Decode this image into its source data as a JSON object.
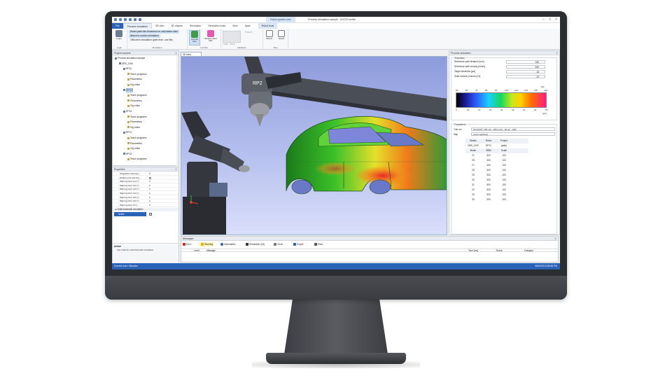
{
  "window": {
    "title": "Process simulation sample - DXC20.xmlite",
    "context_tab_group": "Robot specific tools",
    "context_tab": "Robot tools"
  },
  "ribbon_tabs": [
    "File",
    "Process simulation",
    "3D view",
    "3D objects",
    "Simulation",
    "Simulation tools",
    "View",
    "Apps"
  ],
  "ribbon": {
    "login_label": "Login",
    "login_group": "Login",
    "sim_options": [
      "Reset paint film thickness on calculation start",
      "Attach to motion simulation",
      "Offscreen simulation (path from .cvs file)"
    ],
    "simulation_group": "Simulation",
    "use_list_label": "Use list files",
    "sample_paint_label": "Sample paint files",
    "load_label": "Load",
    "save_label": "Save",
    "list_group": "List files",
    "validation_group": "Validation",
    "export_label": "Export",
    "import_label": "Import",
    "export_small": "Export",
    "map_group": "Map"
  },
  "project_explorer": {
    "title": "Project explorer",
    "items": [
      {
        "label": "Process simulation sample",
        "level": 0
      },
      {
        "label": "DBS_2100",
        "level": 1
      },
      {
        "label": "RP11",
        "level": 2
      },
      {
        "label": "Teach programs",
        "level": 3
      },
      {
        "label": "Parameters",
        "level": 3
      },
      {
        "label": "Cfg editor",
        "level": 3
      },
      {
        "label": "RP12",
        "level": 2,
        "selected": true
      },
      {
        "label": "Teach programs",
        "level": 3
      },
      {
        "label": "Parameters",
        "level": 3
      },
      {
        "label": "Cfg editor",
        "level": 3
      },
      {
        "label": "RP13",
        "level": 2
      },
      {
        "label": "Teach programs",
        "level": 3
      },
      {
        "label": "Parameters",
        "level": 3
      },
      {
        "label": "Cfg editor",
        "level": 3
      },
      {
        "label": "RP21",
        "level": 2
      },
      {
        "label": "Teach programs",
        "level": 3
      },
      {
        "label": "Parameters",
        "level": 3
      },
      {
        "label": "Cfg editor",
        "level": 3
      },
      {
        "label": "RP22",
        "level": 2
      },
      {
        "label": "Teach programs",
        "level": 3
      }
    ]
  },
  "properties": {
    "title": "Properties",
    "rows": [
      {
        "key": "Singularity warning (...",
        "value": "0"
      },
      {
        "key": "Enable joint warning ...",
        "checkbox": true
      },
      {
        "key": "Warning limit 'A1' [°]",
        "value": "0"
      },
      {
        "key": "Warning limit 'A2' [°]",
        "value": "0"
      },
      {
        "key": "Warning limit 'A3' [°]",
        "value": "0"
      },
      {
        "key": "Warning limit 'A4' [°]",
        "value": "0"
      },
      {
        "key": "Warning limit 'A5' [°]",
        "value": "0"
      },
      {
        "key": "Warning limit 'A6' [°]",
        "value": "0"
      },
      {
        "key": "Warning limit 'A7' [...",
        "value": "0"
      }
    ],
    "section": "Multi kinematic simulation",
    "active_label": "Active",
    "desc_title": "Active",
    "desc_text": "Use robot for multi kinematic simulation"
  },
  "view3d": {
    "tab": "3D view",
    "robot_label": "RP2"
  },
  "process_sim": {
    "title": "Process simulation",
    "simulation_group": "Simulation",
    "fields": [
      {
        "label": "Reference path distance [mm]",
        "value": "150"
      },
      {
        "label": "Reference path velocity [mm/s]",
        "value": "450"
      },
      {
        "label": "Target thickness [µm]",
        "value": "18"
      },
      {
        "label": "Solid content (volume) [%]",
        "value": "23"
      }
    ],
    "scale_ticks": [
      "50",
      "60",
      "75",
      "85",
      "90",
      "100",
      "110",
      "125",
      "135",
      "145"
    ],
    "scale_unit_top": "[%]",
    "scale_bottom": [
      "0",
      "10",
      "13",
      "15",
      "16",
      "18",
      "21",
      "23",
      "25"
    ],
    "scale_unit_bottom": "[µm]",
    "parameters_group": "Parameters",
    "trial_label": "Trial run",
    "trial_value": "23.29 PM | 150 mm - 450 mm/s - 18 µm - 23%",
    "map_label": "Map",
    "map_value": "(none selected)",
    "table_header": [
      "Station",
      "Robot",
      "Project"
    ],
    "station_row": [
      "DBS_2100",
      "RP11",
      "(path)"
    ],
    "sub_header": [
      "Brush",
      "SB50",
      "Scale"
    ],
    "rows": [
      [
        "21",
        "500",
        "100"
      ],
      [
        "25",
        "500",
        "100"
      ],
      [
        "27",
        "500",
        "100"
      ],
      [
        "28",
        "500",
        "100"
      ],
      [
        "29",
        "500",
        "100"
      ],
      [
        "30",
        "500",
        "100"
      ],
      [
        "31",
        "500",
        "100"
      ],
      [
        "32",
        "500",
        "100"
      ],
      [
        "33",
        "500",
        "100"
      ],
      [
        "34",
        "500",
        "100"
      ]
    ]
  },
  "messages": {
    "title": "Messages",
    "buttons": [
      "Error",
      "Warning",
      "Information",
      "Simulation (26)",
      "Clear",
      "Export",
      "View"
    ],
    "columns": [
      "Level",
      "Message",
      "Time [ms]",
      "Robot",
      "Category"
    ]
  },
  "status": {
    "user": "Current user: Sitoncho",
    "datetime": "8/6/2020 5:36:58 PM"
  },
  "colors": {
    "accent": "#2a62b8",
    "sky_top": "#8e9bdc",
    "sky_bottom": "#d9defa"
  }
}
